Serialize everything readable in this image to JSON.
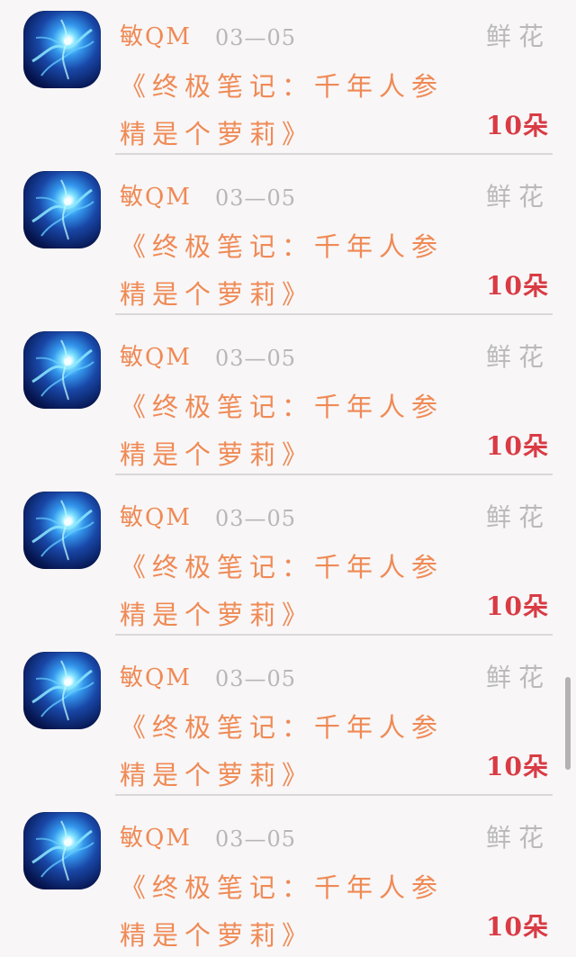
{
  "items": [
    {
      "name": "敏QM",
      "date": "03—05",
      "gift": "鲜花",
      "title_line1": "《终极笔记：千年人参",
      "title_line2": "精是个萝莉》",
      "count": "10朵"
    },
    {
      "name": "敏QM",
      "date": "03—05",
      "gift": "鲜花",
      "title_line1": "《终极笔记：千年人参",
      "title_line2": "精是个萝莉》",
      "count": "10朵"
    },
    {
      "name": "敏QM",
      "date": "03—05",
      "gift": "鲜花",
      "title_line1": "《终极笔记：千年人参",
      "title_line2": "精是个萝莉》",
      "count": "10朵"
    },
    {
      "name": "敏QM",
      "date": "03—05",
      "gift": "鲜花",
      "title_line1": "《终极笔记：千年人参",
      "title_line2": "精是个萝莉》",
      "count": "10朵"
    },
    {
      "name": "敏QM",
      "date": "03—05",
      "gift": "鲜花",
      "title_line1": "《终极笔记：千年人参",
      "title_line2": "精是个萝莉》",
      "count": "10朵"
    },
    {
      "name": "敏QM",
      "date": "03—05",
      "gift": "鲜花",
      "title_line1": "《终极笔记：千年人参",
      "title_line2": "精是个萝莉》",
      "count": "10朵"
    }
  ],
  "colors": {
    "accent": "#ef8a55",
    "count": "#d93b44",
    "muted": "#b7b7b7",
    "background": "#f8f6f7"
  },
  "icons": {
    "avatar": "blue-abstract-avatar-icon"
  }
}
